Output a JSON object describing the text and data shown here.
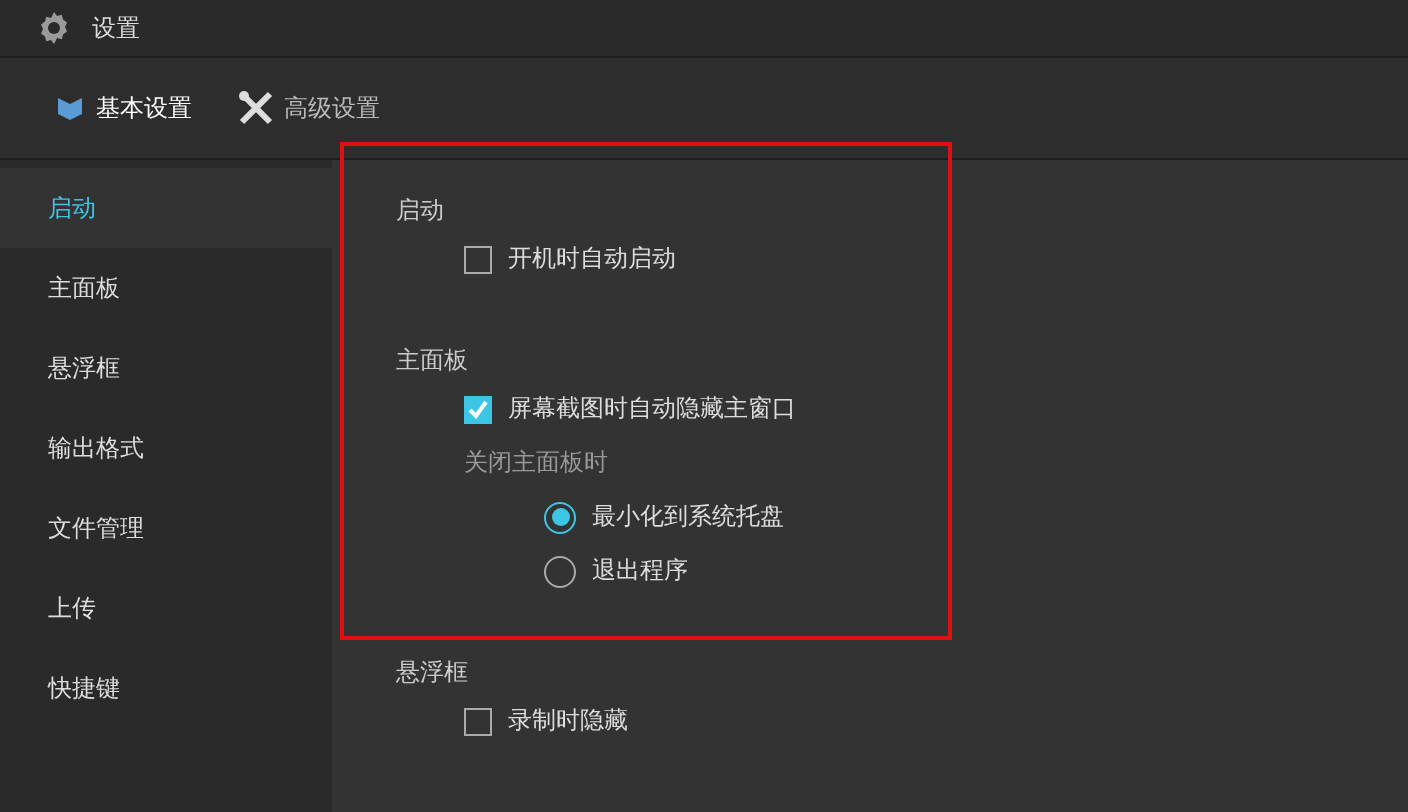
{
  "window": {
    "title": "设置"
  },
  "tabs": [
    {
      "label": "基本设置",
      "selected": true
    },
    {
      "label": "高级设置",
      "selected": false
    }
  ],
  "sidebar": {
    "items": [
      {
        "label": "启动",
        "selected": true
      },
      {
        "label": "主面板",
        "selected": false
      },
      {
        "label": "悬浮框",
        "selected": false
      },
      {
        "label": "输出格式",
        "selected": false
      },
      {
        "label": "文件管理",
        "selected": false
      },
      {
        "label": "上传",
        "selected": false
      },
      {
        "label": "快捷键",
        "selected": false
      }
    ]
  },
  "highlight": {
    "on": true
  },
  "sections": [
    {
      "title": "启动",
      "items": [
        {
          "kind": "checkbox",
          "label": "开机时自动启动",
          "checked": false
        }
      ]
    },
    {
      "title": "主面板",
      "items": [
        {
          "kind": "checkbox",
          "label": "屏幕截图时自动隐藏主窗口",
          "checked": true
        },
        {
          "kind": "caption",
          "label": "关闭主面板时"
        },
        {
          "kind": "radio",
          "label": "最小化到系统托盘",
          "selected": true
        },
        {
          "kind": "radio",
          "label": "退出程序",
          "selected": false
        }
      ]
    },
    {
      "title": "悬浮框",
      "items": [
        {
          "kind": "checkbox",
          "label": "录制时隐藏",
          "checked": false
        }
      ]
    }
  ]
}
